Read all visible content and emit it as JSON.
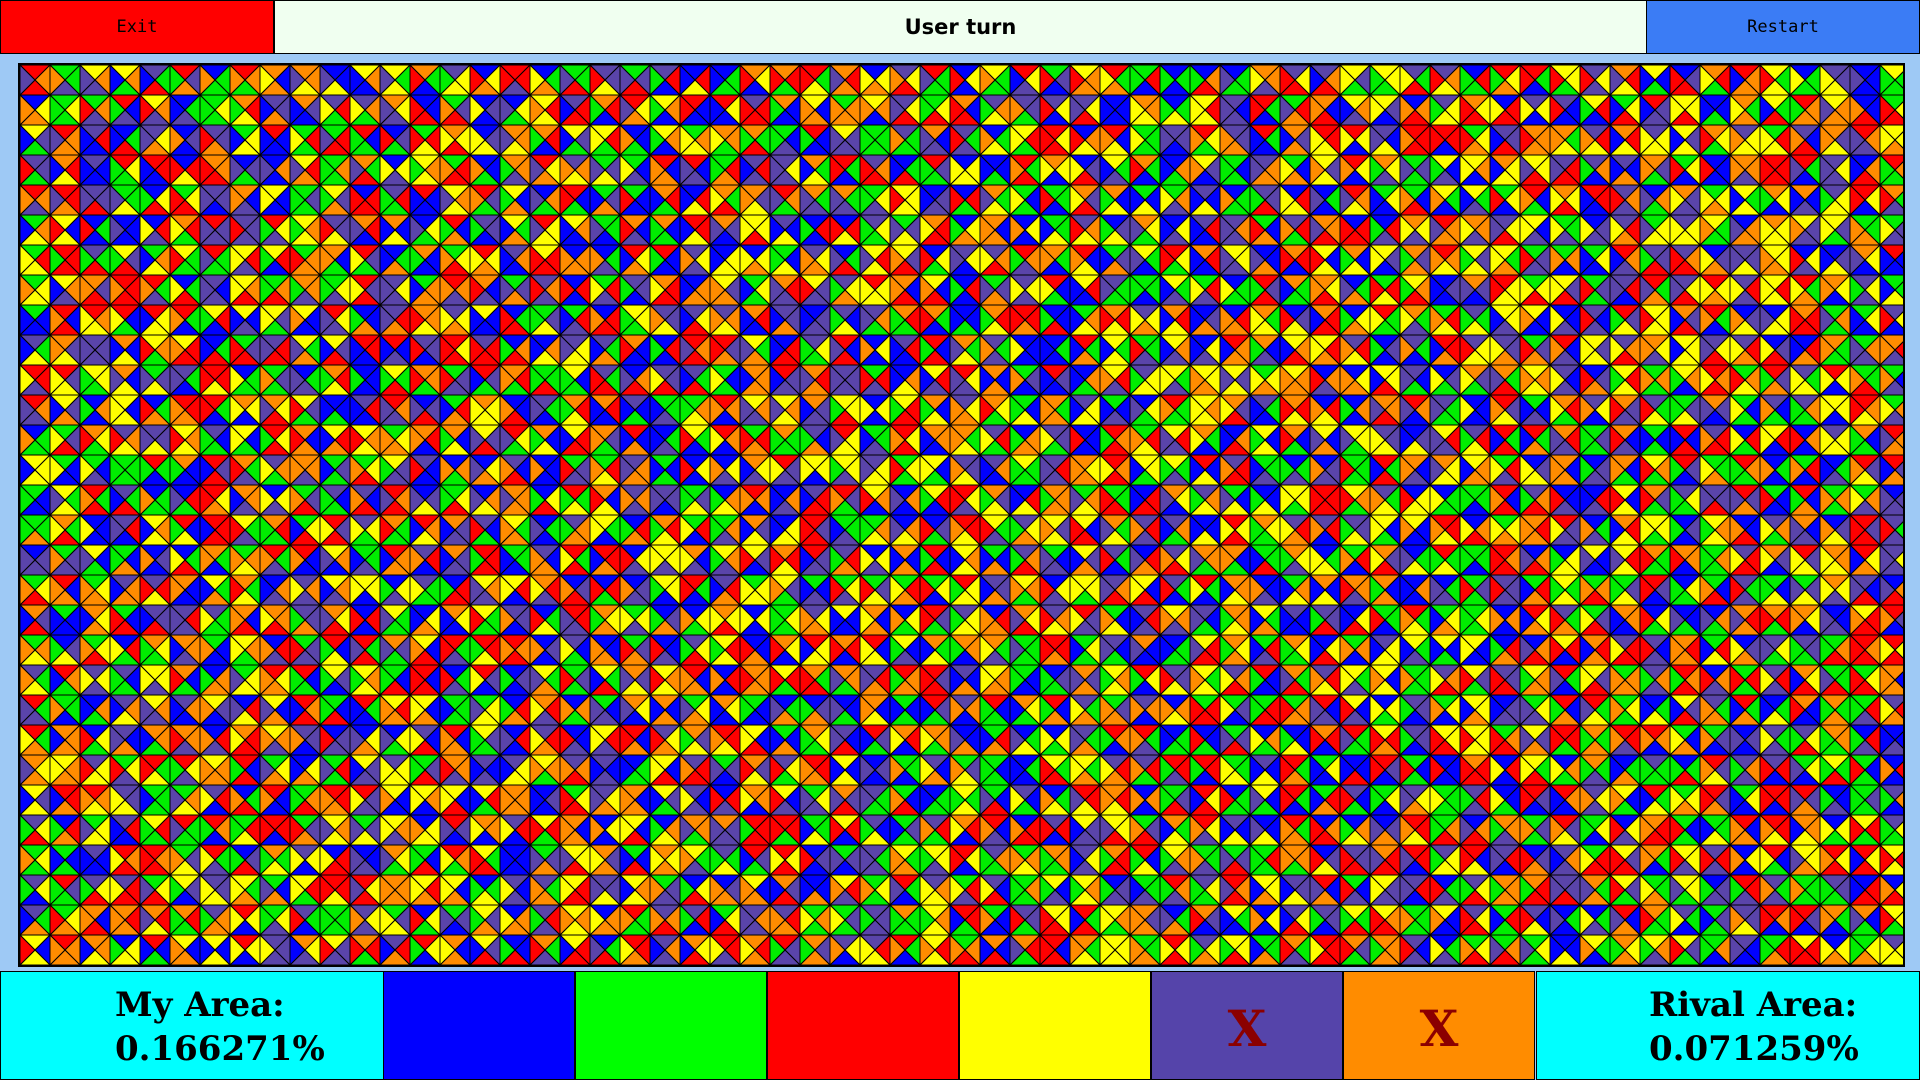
{
  "toolbar": {
    "exit_label": "Exit",
    "status_text": "User turn",
    "restart_label": "Restart"
  },
  "board": {
    "palette": [
      "#0000ff",
      "#00ee00",
      "#ff0000",
      "#ffff00",
      "#5a44aa",
      "#ff8c00"
    ]
  },
  "scores": {
    "my_label": "My Area:",
    "my_value": "0.166271%",
    "rival_label": "Rival Area:",
    "rival_value": "0.071259%"
  },
  "color_choices": [
    {
      "color": "#0000ff",
      "mark": ""
    },
    {
      "color": "#00ff00",
      "mark": ""
    },
    {
      "color": "#ff0000",
      "mark": ""
    },
    {
      "color": "#ffff00",
      "mark": ""
    },
    {
      "color": "#5544aa",
      "mark": "X"
    },
    {
      "color": "#ff8c00",
      "mark": "X"
    }
  ],
  "mark_color": "#8b0000"
}
